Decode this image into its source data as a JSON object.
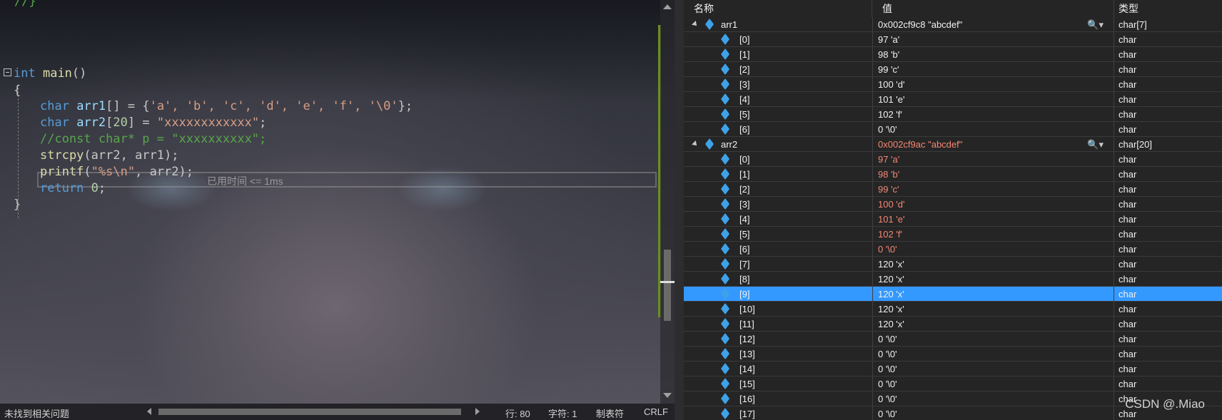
{
  "editor": {
    "top_comment": "//}",
    "code": {
      "line_main": {
        "kw": "int",
        "fn": "main",
        "rest": "()"
      },
      "brace_open": "{",
      "line_arr1": {
        "kw": "char",
        "var": "arr1",
        "rest": "[] = {",
        "chars": "'a', 'b', 'c', 'd', 'e', 'f', '\\0'",
        "end": "};"
      },
      "line_arr2": {
        "kw": "char",
        "var": "arr2",
        "rest1": "[",
        "num": "20",
        "rest2": "] = ",
        "str": "\"xxxxxxxxxxxx\"",
        "end": ";"
      },
      "line_comment": "//const char* p = \"xxxxxxxxxx\";",
      "line_strcpy": {
        "fn": "strcpy",
        "args": "(arr2, arr1);"
      },
      "line_printf": {
        "fn": "printf",
        "open": "(",
        "str": "\"%s\\n\"",
        "rest": ", arr2);"
      },
      "line_return": {
        "kw": "return",
        "num": "0",
        "end": ";"
      },
      "brace_close": "}"
    },
    "elapsed_hint": "已用时间 <= 1ms"
  },
  "status_bar": {
    "issues": "未找到相关问题",
    "line": "行: 80",
    "char": "字符: 1",
    "indent": "制表符",
    "eol": "CRLF"
  },
  "watch": {
    "headers": {
      "name": "名称",
      "value": "值",
      "type": "类型"
    },
    "search_icon": "🔍▾",
    "arr1": {
      "name": "arr1",
      "value": "0x002cf9c8 \"abcdef\"",
      "type": "char[7]"
    },
    "arr1_items": [
      {
        "name": "[0]",
        "value": "97 'a'",
        "type": "char"
      },
      {
        "name": "[1]",
        "value": "98 'b'",
        "type": "char"
      },
      {
        "name": "[2]",
        "value": "99 'c'",
        "type": "char"
      },
      {
        "name": "[3]",
        "value": "100 'd'",
        "type": "char"
      },
      {
        "name": "[4]",
        "value": "101 'e'",
        "type": "char"
      },
      {
        "name": "[5]",
        "value": "102 'f'",
        "type": "char"
      },
      {
        "name": "[6]",
        "value": "0 '\\0'",
        "type": "char"
      }
    ],
    "arr2": {
      "name": "arr2",
      "value": "0x002cf9ac \"abcdef\"",
      "type": "char[20]"
    },
    "arr2_items": [
      {
        "name": "[0]",
        "value": "97 'a'",
        "type": "char"
      },
      {
        "name": "[1]",
        "value": "98 'b'",
        "type": "char"
      },
      {
        "name": "[2]",
        "value": "99 'c'",
        "type": "char"
      },
      {
        "name": "[3]",
        "value": "100 'd'",
        "type": "char"
      },
      {
        "name": "[4]",
        "value": "101 'e'",
        "type": "char"
      },
      {
        "name": "[5]",
        "value": "102 'f'",
        "type": "char"
      },
      {
        "name": "[6]",
        "value": "0 '\\0'",
        "type": "char"
      },
      {
        "name": "[7]",
        "value": "120 'x'",
        "type": "char"
      },
      {
        "name": "[8]",
        "value": "120 'x'",
        "type": "char"
      },
      {
        "name": "[9]",
        "value": "120 'x'",
        "type": "char"
      },
      {
        "name": "[10]",
        "value": "120 'x'",
        "type": "char"
      },
      {
        "name": "[11]",
        "value": "120 'x'",
        "type": "char"
      },
      {
        "name": "[12]",
        "value": "0 '\\0'",
        "type": "char"
      },
      {
        "name": "[13]",
        "value": "0 '\\0'",
        "type": "char"
      },
      {
        "name": "[14]",
        "value": "0 '\\0'",
        "type": "char"
      },
      {
        "name": "[15]",
        "value": "0 '\\0'",
        "type": "char"
      },
      {
        "name": "[16]",
        "value": "0 '\\0'",
        "type": "char"
      },
      {
        "name": "[17]",
        "value": "0 '\\0'",
        "type": "char"
      }
    ]
  },
  "watermark": "CSDN @.Miao"
}
